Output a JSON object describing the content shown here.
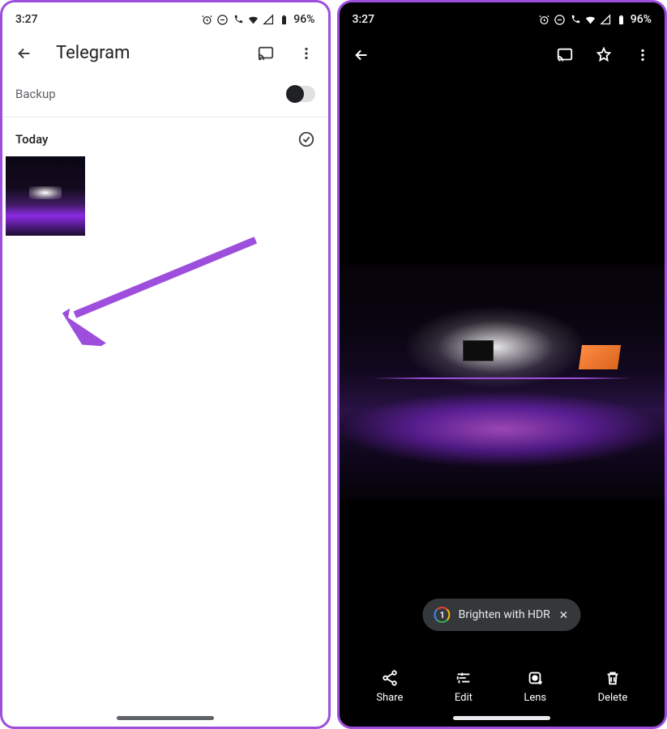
{
  "status": {
    "time": "3:27",
    "battery_pct": "96%"
  },
  "left": {
    "title": "Telegram",
    "backup_label": "Backup",
    "section_label": "Today"
  },
  "right": {
    "hdr_pill": "Brighten with HDR",
    "actions": {
      "share": "Share",
      "edit": "Edit",
      "lens": "Lens",
      "delete": "Delete"
    }
  }
}
